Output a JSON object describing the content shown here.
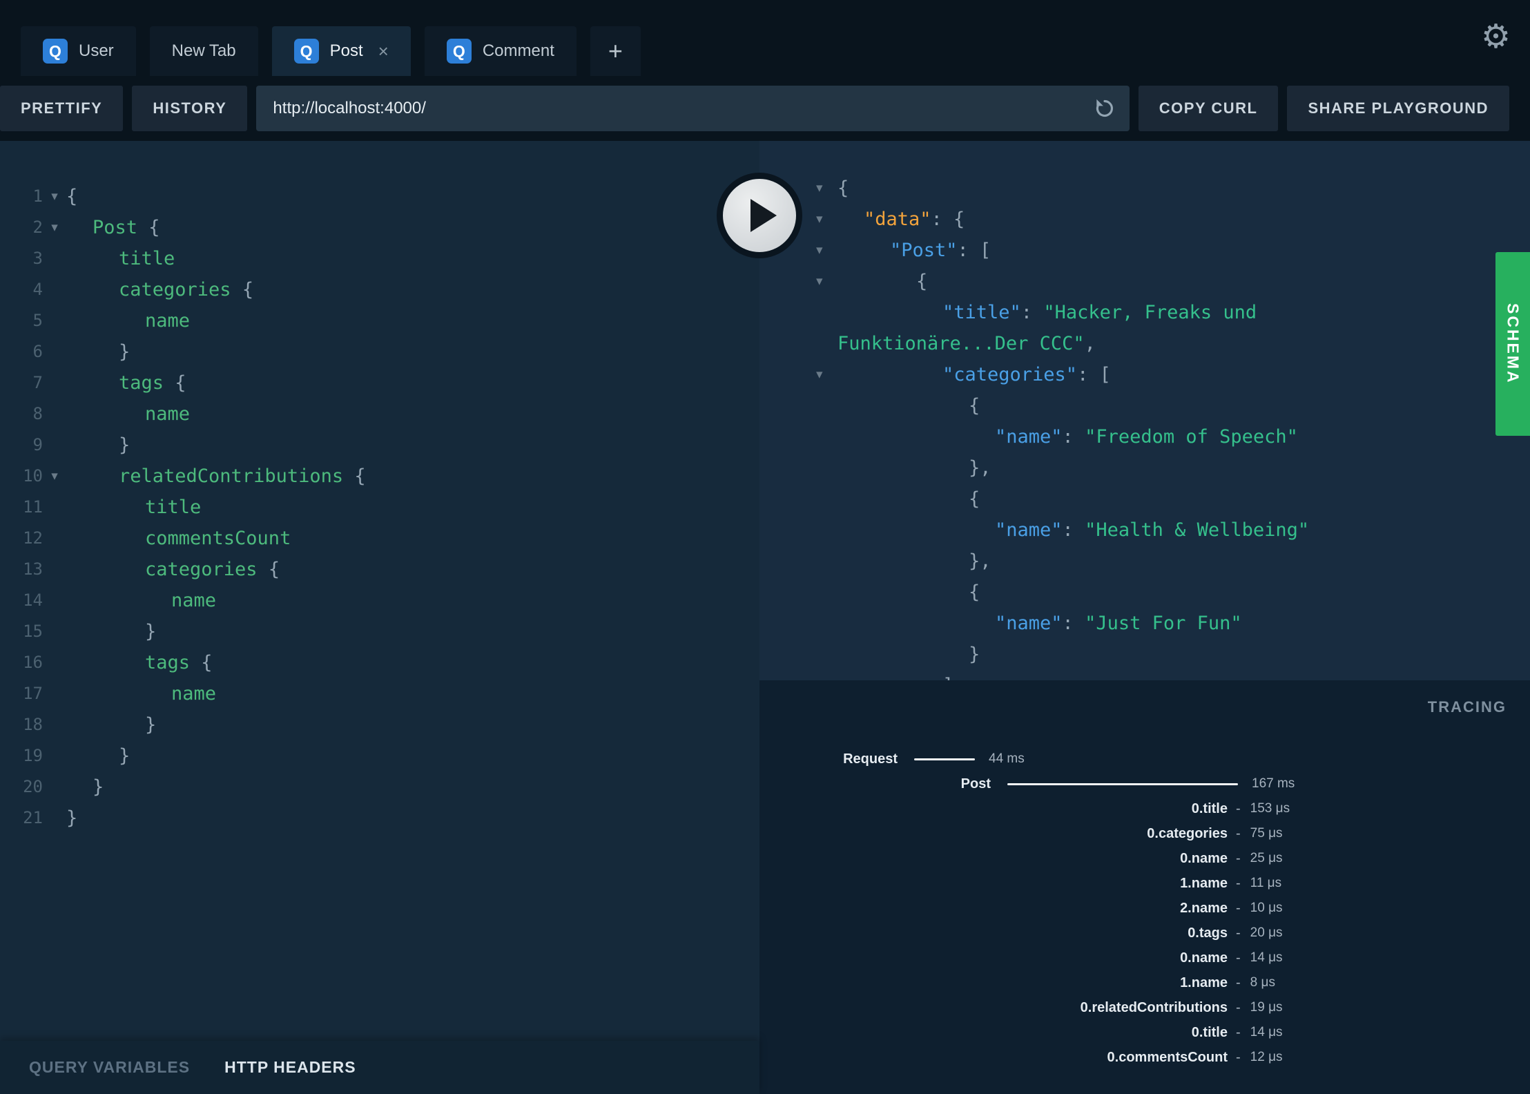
{
  "icons": {
    "gear": "⚙",
    "close": "×",
    "plus": "+",
    "fold": "▾"
  },
  "colors": {
    "accent_blue": "#2d7fd8",
    "schema_green": "#27b05e",
    "key_blue": "#4aa0e6",
    "string_green": "#35c08c",
    "data_orange": "#f2a33c",
    "field_green": "#4dba7d"
  },
  "tabs": {
    "items": [
      {
        "label": "User",
        "badge": "Q",
        "active": false,
        "closable": false
      },
      {
        "label": "New Tab",
        "badge": null,
        "active": false,
        "closable": false
      },
      {
        "label": "Post",
        "badge": "Q",
        "active": true,
        "closable": true
      },
      {
        "label": "Comment",
        "badge": "Q",
        "active": false,
        "closable": false
      },
      {
        "label": "+",
        "plus": true
      }
    ]
  },
  "toolbar": {
    "prettify": "PRETTIFY",
    "history": "HISTORY",
    "url": "http://localhost:4000/",
    "copy_curl": "COPY CURL",
    "share": "SHARE PLAYGROUND"
  },
  "query": {
    "lines": [
      {
        "n": 1,
        "fold": true,
        "indent": 0,
        "tokens": [
          [
            "p",
            "{"
          ]
        ]
      },
      {
        "n": 2,
        "fold": true,
        "indent": 1,
        "tokens": [
          [
            "f",
            "Post"
          ],
          [
            "p",
            " {"
          ]
        ]
      },
      {
        "n": 3,
        "fold": false,
        "indent": 2,
        "tokens": [
          [
            "f",
            "title"
          ]
        ]
      },
      {
        "n": 4,
        "fold": false,
        "indent": 2,
        "tokens": [
          [
            "f",
            "categories"
          ],
          [
            "p",
            " {"
          ]
        ]
      },
      {
        "n": 5,
        "fold": false,
        "indent": 3,
        "tokens": [
          [
            "f",
            "name"
          ]
        ]
      },
      {
        "n": 6,
        "fold": false,
        "indent": 2,
        "tokens": [
          [
            "p",
            "}"
          ]
        ]
      },
      {
        "n": 7,
        "fold": false,
        "indent": 2,
        "tokens": [
          [
            "f",
            "tags"
          ],
          [
            "p",
            " {"
          ]
        ]
      },
      {
        "n": 8,
        "fold": false,
        "indent": 3,
        "tokens": [
          [
            "f",
            "name"
          ]
        ]
      },
      {
        "n": 9,
        "fold": false,
        "indent": 2,
        "tokens": [
          [
            "p",
            "}"
          ]
        ]
      },
      {
        "n": 10,
        "fold": true,
        "indent": 2,
        "tokens": [
          [
            "f",
            "relatedContributions"
          ],
          [
            "p",
            " {"
          ]
        ]
      },
      {
        "n": 11,
        "fold": false,
        "indent": 3,
        "tokens": [
          [
            "f",
            "title"
          ]
        ]
      },
      {
        "n": 12,
        "fold": false,
        "indent": 3,
        "tokens": [
          [
            "f",
            "commentsCount"
          ]
        ]
      },
      {
        "n": 13,
        "fold": false,
        "indent": 3,
        "tokens": [
          [
            "f",
            "categories"
          ],
          [
            "p",
            " {"
          ]
        ]
      },
      {
        "n": 14,
        "fold": false,
        "indent": 4,
        "tokens": [
          [
            "f",
            "name"
          ]
        ]
      },
      {
        "n": 15,
        "fold": false,
        "indent": 3,
        "tokens": [
          [
            "p",
            "}"
          ]
        ]
      },
      {
        "n": 16,
        "fold": false,
        "indent": 3,
        "tokens": [
          [
            "f",
            "tags"
          ],
          [
            "p",
            " {"
          ]
        ]
      },
      {
        "n": 17,
        "fold": false,
        "indent": 4,
        "tokens": [
          [
            "f",
            "name"
          ]
        ]
      },
      {
        "n": 18,
        "fold": false,
        "indent": 3,
        "tokens": [
          [
            "p",
            "}"
          ]
        ]
      },
      {
        "n": 19,
        "fold": false,
        "indent": 2,
        "tokens": [
          [
            "p",
            "}"
          ]
        ]
      },
      {
        "n": 20,
        "fold": false,
        "indent": 1,
        "tokens": [
          [
            "p",
            "}"
          ]
        ]
      },
      {
        "n": 21,
        "fold": false,
        "indent": 0,
        "tokens": [
          [
            "p",
            "}"
          ]
        ]
      }
    ]
  },
  "response": {
    "lines": [
      {
        "fold": true,
        "indent": 0,
        "tokens": [
          [
            "p",
            "{"
          ]
        ]
      },
      {
        "fold": true,
        "indent": 1,
        "tokens": [
          [
            "d",
            "\"data\""
          ],
          [
            "p",
            ": {"
          ]
        ]
      },
      {
        "fold": true,
        "indent": 2,
        "tokens": [
          [
            "k",
            "\"Post\""
          ],
          [
            "p",
            ": ["
          ]
        ]
      },
      {
        "fold": true,
        "indent": 3,
        "tokens": [
          [
            "p",
            "{"
          ]
        ]
      },
      {
        "fold": false,
        "indent": 4,
        "tokens": [
          [
            "k",
            "\"title\""
          ],
          [
            "p",
            ": "
          ],
          [
            "s",
            "\"Hacker, Freaks und"
          ]
        ]
      },
      {
        "fold": false,
        "indent": 0,
        "tokens": [
          [
            "s",
            "Funktionäre...Der CCC\""
          ],
          [
            "p",
            ","
          ]
        ]
      },
      {
        "fold": true,
        "indent": 4,
        "tokens": [
          [
            "k",
            "\"categories\""
          ],
          [
            "p",
            ": ["
          ]
        ]
      },
      {
        "fold": false,
        "indent": 5,
        "tokens": [
          [
            "p",
            "{"
          ]
        ]
      },
      {
        "fold": false,
        "indent": 6,
        "tokens": [
          [
            "k",
            "\"name\""
          ],
          [
            "p",
            ": "
          ],
          [
            "s",
            "\"Freedom of Speech\""
          ]
        ]
      },
      {
        "fold": false,
        "indent": 5,
        "tokens": [
          [
            "p",
            "},"
          ]
        ]
      },
      {
        "fold": false,
        "indent": 5,
        "tokens": [
          [
            "p",
            "{"
          ]
        ]
      },
      {
        "fold": false,
        "indent": 6,
        "tokens": [
          [
            "k",
            "\"name\""
          ],
          [
            "p",
            ": "
          ],
          [
            "s",
            "\"Health & Wellbeing\""
          ]
        ]
      },
      {
        "fold": false,
        "indent": 5,
        "tokens": [
          [
            "p",
            "},"
          ]
        ]
      },
      {
        "fold": false,
        "indent": 5,
        "tokens": [
          [
            "p",
            "{"
          ]
        ]
      },
      {
        "fold": false,
        "indent": 6,
        "tokens": [
          [
            "k",
            "\"name\""
          ],
          [
            "p",
            ": "
          ],
          [
            "s",
            "\"Just For Fun\""
          ]
        ]
      },
      {
        "fold": false,
        "indent": 5,
        "tokens": [
          [
            "p",
            "}"
          ]
        ]
      },
      {
        "fold": false,
        "indent": 4,
        "tokens": [
          [
            "p",
            "],"
          ]
        ]
      }
    ]
  },
  "schema_tab": "SCHEMA",
  "tracing": {
    "title": "TRACING",
    "rows": [
      {
        "type": "request",
        "label": "Request",
        "ms": 44,
        "value": "44 ms"
      },
      {
        "type": "post",
        "label": "Post",
        "ms": 167,
        "value": "167 ms"
      },
      {
        "type": "leaf",
        "label": "0.title",
        "value": "153 μs"
      },
      {
        "type": "leaf",
        "label": "0.categories",
        "value": "75 μs"
      },
      {
        "type": "leaf",
        "label": "0.name",
        "value": "25 μs"
      },
      {
        "type": "leaf",
        "label": "1.name",
        "value": "11 μs"
      },
      {
        "type": "leaf",
        "label": "2.name",
        "value": "10 μs"
      },
      {
        "type": "leaf",
        "label": "0.tags",
        "value": "20 μs"
      },
      {
        "type": "leaf",
        "label": "0.name",
        "value": "14 μs"
      },
      {
        "type": "leaf",
        "label": "1.name",
        "value": "8 μs"
      },
      {
        "type": "leaf",
        "label": "0.relatedContributions",
        "value": "19 μs"
      },
      {
        "type": "leaf",
        "label": "0.title",
        "value": "14 μs"
      },
      {
        "type": "leaf",
        "label": "0.commentsCount",
        "value": "12 μs"
      }
    ]
  },
  "footer": {
    "query_variables": "QUERY VARIABLES",
    "http_headers": "HTTP HEADERS"
  }
}
